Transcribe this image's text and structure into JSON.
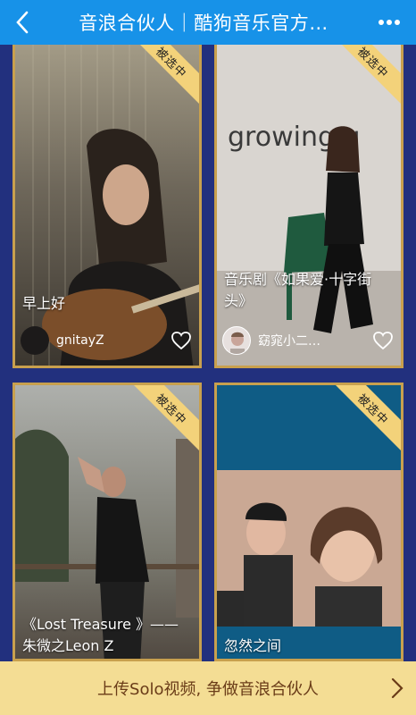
{
  "header": {
    "title": "音浪合伙人｜酷狗音乐官方…"
  },
  "badge_label": "被选中",
  "cards": [
    {
      "title": "早上好",
      "user": "gnitayZ"
    },
    {
      "title": "音乐剧《如果爱·十字街头》",
      "user": "窈窕小二…",
      "wall_text": "growing g"
    },
    {
      "title": "《Lost Treasure 》——朱微之Leon Z"
    },
    {
      "title": "忽然之间"
    }
  ],
  "footer": {
    "cta": "上传Solo视频, 争做音浪合伙人"
  },
  "colors": {
    "header_bg": "#1792e8",
    "page_bg": "#22307e",
    "card_border": "#c8a04e",
    "badge_bg": "#f3d27a",
    "footer_bg": "#f4dd94",
    "footer_text": "#6a3c18"
  }
}
